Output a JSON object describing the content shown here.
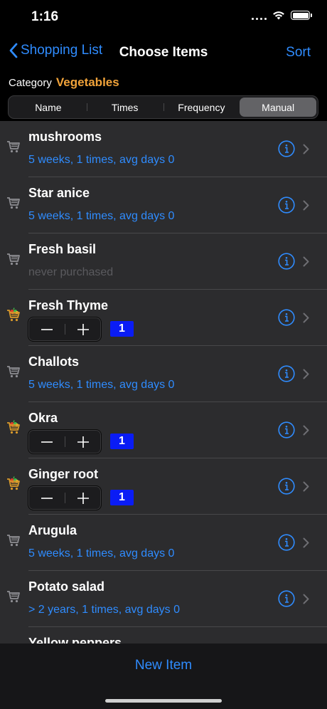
{
  "status": {
    "time": "1:16"
  },
  "nav": {
    "back_label": "Shopping List",
    "title": "Choose Items",
    "sort_label": "Sort"
  },
  "category": {
    "label": "Category",
    "value": "Vegetables"
  },
  "segments": [
    {
      "label": "Name",
      "selected": false
    },
    {
      "label": "Times",
      "selected": false
    },
    {
      "label": "Frequency",
      "selected": false
    },
    {
      "label": "Manual",
      "selected": true
    }
  ],
  "items": [
    {
      "name": "mushrooms",
      "subtitle": "5 weeks, 1 times, avg days 0",
      "in_cart": false,
      "quantity": null,
      "never": false
    },
    {
      "name": "Star anice",
      "subtitle": "5 weeks, 1 times, avg days 0",
      "in_cart": false,
      "quantity": null,
      "never": false
    },
    {
      "name": "Fresh basil",
      "subtitle": "never purchased",
      "in_cart": false,
      "quantity": null,
      "never": true
    },
    {
      "name": "Fresh Thyme",
      "subtitle": "",
      "in_cart": true,
      "quantity": "1",
      "never": false
    },
    {
      "name": "Challots",
      "subtitle": "5 weeks, 1 times, avg days 0",
      "in_cart": false,
      "quantity": null,
      "never": false
    },
    {
      "name": "Okra",
      "subtitle": "",
      "in_cart": true,
      "quantity": "1",
      "never": false
    },
    {
      "name": "Ginger root",
      "subtitle": "",
      "in_cart": true,
      "quantity": "1",
      "never": false
    },
    {
      "name": "Arugula",
      "subtitle": "5 weeks, 1 times, avg days 0",
      "in_cart": false,
      "quantity": null,
      "never": false
    },
    {
      "name": "Potato salad",
      "subtitle": "> 2 years, 1 times, avg days 0",
      "in_cart": false,
      "quantity": null,
      "never": false
    },
    {
      "name": "Yellow peppers",
      "subtitle": "",
      "in_cart": false,
      "quantity": null,
      "never": false
    }
  ],
  "bottom": {
    "new_item_label": "New Item"
  },
  "colors": {
    "accent": "#2f8cff",
    "category": "#f1a33a",
    "badge": "#0a1cf5",
    "row_bg": "#2c2c2e"
  },
  "icons": {
    "back": "chevron-left-icon",
    "cart_empty": "shopping-cart-gray-icon",
    "cart_full": "shopping-cart-with-vegetables-icon",
    "info": "info-circle-icon",
    "disclosure": "chevron-right-icon",
    "minus": "minus-icon",
    "plus": "plus-icon"
  }
}
